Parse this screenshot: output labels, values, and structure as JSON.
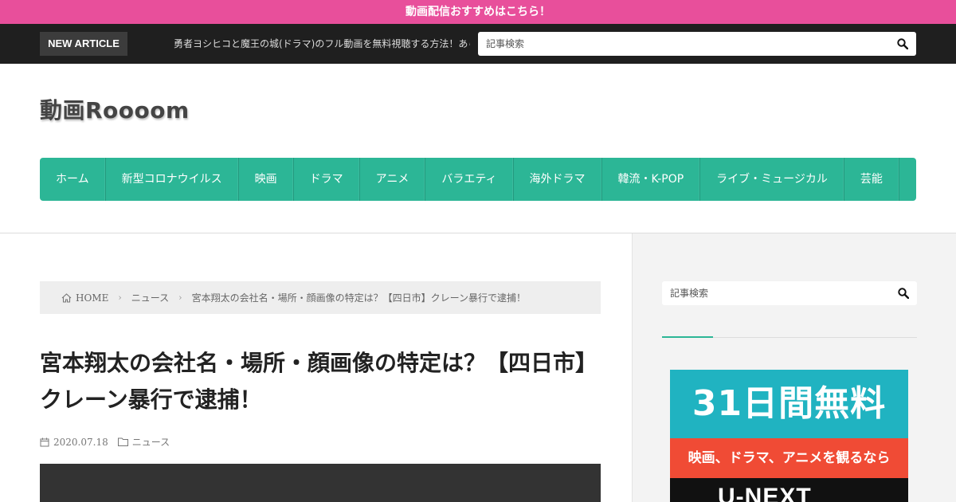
{
  "promo": {
    "text": "動画配信おすすめはこちら！"
  },
  "topbar": {
    "badge": "NEW ARTICLE",
    "ticker": "勇者ヨシヒコと魔王の城(ドラマ)のフル動画を無料視聴する方法！あらすじ・キャスト",
    "search_placeholder": "記事検索"
  },
  "site": {
    "title": "動画Roooom"
  },
  "nav": {
    "items": [
      "ホーム",
      "新型コロナウイルス",
      "映画",
      "ドラマ",
      "アニメ",
      "バラエティ",
      "海外ドラマ",
      "韓流・K-POP",
      "ライブ・ミュージカル",
      "芸能"
    ]
  },
  "breadcrumb": {
    "home": "HOME",
    "category": "ニュース",
    "current": "宮本翔太の会社名・場所・顔画像の特定は？【四日市】クレーン暴行で逮捕！"
  },
  "post": {
    "title": "宮本翔太の会社名・場所・顔画像の特定は？【四日市】クレーン暴行で逮捕！",
    "date": "2020.07.18",
    "category": "ニュース"
  },
  "sidebar": {
    "search_placeholder": "記事検索",
    "ad": {
      "headline": "31日間無料",
      "subline": "映画、ドラマ、アニメを観るなら",
      "brand": "U-NEXT"
    }
  },
  "colors": {
    "promo": "#e84f9b",
    "nav": "#2cb696",
    "topbar": "#1f1f1f"
  },
  "icons": [
    "search-icon",
    "home-icon",
    "calendar-icon",
    "folder-icon",
    "chevron-right-icon"
  ]
}
